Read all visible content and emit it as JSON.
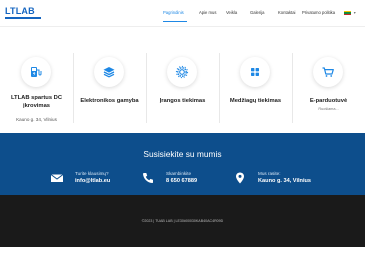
{
  "header": {
    "logo_text": "LTLAB",
    "nav": [
      {
        "label": "Pagrindinis",
        "active": true
      },
      {
        "label": "Apie mus",
        "active": false
      },
      {
        "label": "Veikla",
        "active": false
      },
      {
        "label": "Galerija",
        "active": false
      },
      {
        "label": "Kontaktai",
        "active": false
      },
      {
        "label": "Privatumo politika",
        "active": false
      }
    ],
    "language_selected": "Lietuvių",
    "language_icon": "lithuania-flag-icon"
  },
  "services": [
    {
      "title": "LTLAB spartus DC įkrovimas",
      "subtitle": "Kauno g. 34, Vilnius",
      "icon": "ev-charger-icon"
    },
    {
      "title": "Elektronikos gamyba",
      "subtitle": "",
      "icon": "layers-icon"
    },
    {
      "title": "Įrangos tiekimas",
      "subtitle": "",
      "icon": "gear-icon"
    },
    {
      "title": "Medžiagų tiekimas",
      "subtitle": "",
      "icon": "grid-icon"
    },
    {
      "title": "E-parduotuvė",
      "subtitle": "Ruošiama...",
      "icon": "shopping-cart-icon"
    }
  ],
  "contact": {
    "title": "Susisiekite su mumis",
    "items": [
      {
        "label": "Turite klausimų?",
        "value": "info@ltlab.eu",
        "icon": "envelope-icon"
      },
      {
        "label": "Skambinkite",
        "value": "8 650 67889",
        "icon": "phone-icon"
      },
      {
        "label": "Mus rasite:",
        "value": "Kauno g. 34, Vilnius",
        "icon": "map-pin-icon"
      }
    ]
  },
  "footer": {
    "copyright": "©2023 | TUAB LAB | LE30#00030KAB40AC4R09D"
  },
  "colors": {
    "accent": "#1e88e5",
    "contact_band": "#0d4e8c",
    "footer": "#1a1a1a"
  }
}
